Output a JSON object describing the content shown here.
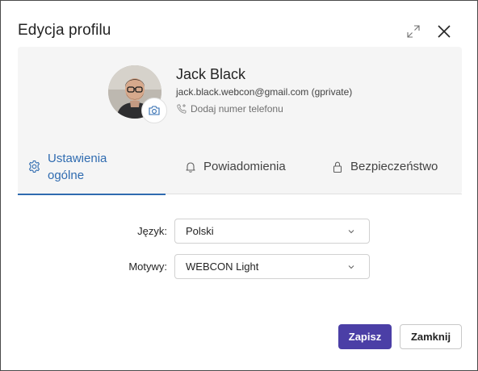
{
  "dialog": {
    "title": "Edycja profilu"
  },
  "profile": {
    "name": "Jack Black",
    "email": "jack.black.webcon@gmail.com (gprivate)",
    "add_phone_label": "Dodaj numer telefonu"
  },
  "tabs": [
    {
      "label": "Ustawienia ogólne",
      "icon": "gear-icon",
      "active": true
    },
    {
      "label": "Powiadomienia",
      "icon": "bell-icon",
      "active": false
    },
    {
      "label": "Bezpieczeństwo",
      "icon": "lock-icon",
      "active": false
    }
  ],
  "form": {
    "language": {
      "label": "Język:",
      "value": "Polski"
    },
    "theme": {
      "label": "Motywy:",
      "value": "WEBCON Light"
    }
  },
  "buttons": {
    "save": "Zapisz",
    "close": "Zamknij"
  },
  "colors": {
    "accent": "#2f6bb0",
    "primary_button": "#4b3fa6"
  }
}
